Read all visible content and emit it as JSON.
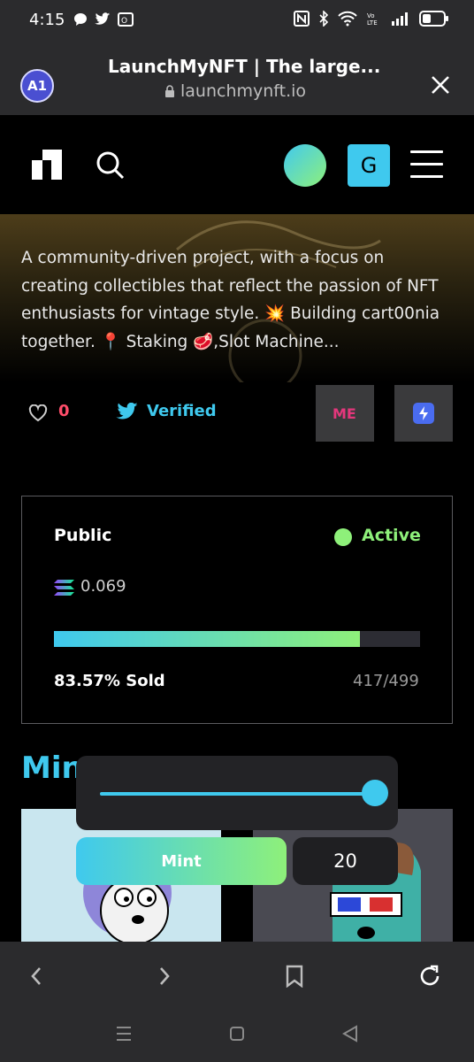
{
  "status_bar": {
    "time": "4:15",
    "left_icons": [
      "chat-bubble-icon",
      "twitter-bird-icon",
      "outlook-icon"
    ],
    "right_icons": [
      "nfc-icon",
      "bluetooth-icon",
      "wifi-icon",
      "volte-icon",
      "signal-icon",
      "battery-icon"
    ]
  },
  "browser": {
    "tab_badge": "A1",
    "title": "LaunchMyNFT | The large...",
    "url": "launchmynft.io"
  },
  "header": {
    "profile_letter": "G"
  },
  "hero": {
    "description": "A community-driven project, with a focus on creating collectibles that reflect the passion of NFT enthusiasts for vintage style. 💥 Building cart00nia together. 📍 Staking 🥩,Slot Machine..."
  },
  "stats": {
    "likes": "0",
    "verified_label": "Verified",
    "marketplace_label": "ME"
  },
  "mint_card": {
    "phase": "Public",
    "status": "Active",
    "price": "0.069",
    "sold_percent_label": "83.57% Sold",
    "sold_count": "417/499",
    "progress_fraction": 0.8357,
    "accent_colors": {
      "cyan": "#3fc9ee",
      "green": "#8ef07a"
    }
  },
  "mint_section": {
    "heading": "Min"
  },
  "mint_controls": {
    "button_label": "Mint",
    "quantity": "20",
    "slider_fraction": 1.0
  }
}
